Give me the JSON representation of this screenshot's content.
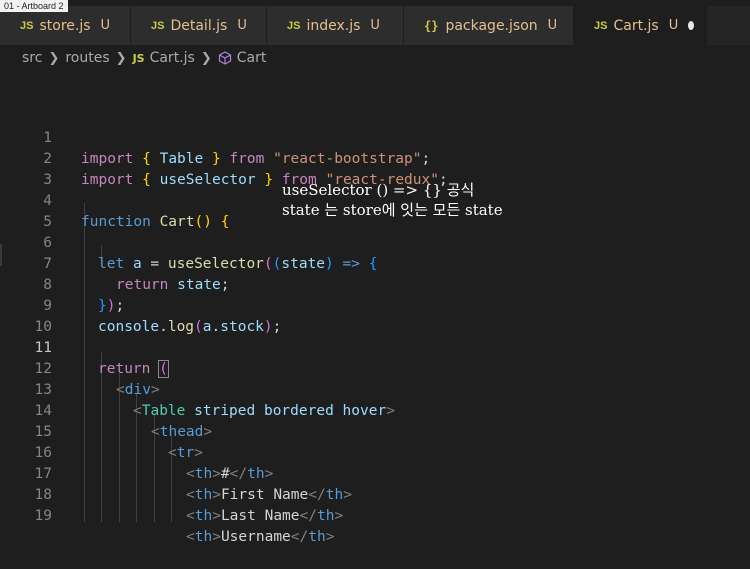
{
  "artboard": "01 - Artboard 2",
  "tabs": [
    {
      "badge": "JS",
      "name": "store.js",
      "status": "U",
      "active": false
    },
    {
      "badge": "JS",
      "name": "Detail.js",
      "status": "U",
      "active": false
    },
    {
      "badge": "JS",
      "name": "index.js",
      "status": "U",
      "active": false
    },
    {
      "badge": "{}",
      "name": "package.json",
      "status": "U",
      "active": false
    },
    {
      "badge": "JS",
      "name": "Cart.js",
      "status": "U",
      "active": true
    }
  ],
  "breadcrumb": {
    "items": [
      "src",
      "routes",
      "Cart.js",
      "Cart"
    ],
    "js_badge": "JS"
  },
  "line_numbers": [
    "1",
    "2",
    "3",
    "4",
    "5",
    "6",
    "7",
    "8",
    "9",
    "10",
    "11",
    "12",
    "13",
    "14",
    "15",
    "16",
    "17",
    "18",
    "19"
  ],
  "code": {
    "l1": [
      "import",
      " ",
      "{",
      " Table ",
      "}",
      " from ",
      "\"react-bootstrap\"",
      ";"
    ],
    "l2": [
      "import",
      " ",
      "{",
      " useSelector ",
      "}",
      " from ",
      "\"react-redux\"",
      ";"
    ],
    "l4": [
      "function",
      " ",
      "Cart",
      "()",
      " ",
      "{"
    ],
    "l6": [
      "let",
      " ",
      "a",
      " = ",
      "useSelector",
      "(",
      "(",
      "state",
      ")",
      " => ",
      "{"
    ],
    "l7": [
      "return",
      " ",
      "state",
      ";"
    ],
    "l8": [
      "}",
      ")",
      ";"
    ],
    "l9": [
      "console",
      ".",
      "log",
      "(",
      "a",
      ".",
      "stock",
      ")",
      ";"
    ],
    "l11": [
      "return",
      " ",
      "("
    ],
    "l12": [
      "<",
      "div",
      ">"
    ],
    "l13": [
      "<",
      "Table",
      " ",
      "striped",
      " ",
      "bordered",
      " ",
      "hover",
      ">"
    ],
    "l14": [
      "<",
      "thead",
      ">"
    ],
    "l15": [
      "<",
      "tr",
      ">"
    ],
    "l16": [
      "<",
      "th",
      ">",
      "#",
      "</",
      "th",
      ">"
    ],
    "l17": [
      "<",
      "th",
      ">",
      "First Name",
      "</",
      "th",
      ">"
    ],
    "l18": [
      "<",
      "th",
      ">",
      "Last Name",
      "</",
      "th",
      ">"
    ],
    "l19": [
      "<",
      "th",
      ">",
      "Username",
      "</",
      "th",
      ">"
    ]
  },
  "note": {
    "line1": "useSelector () => {}  공식",
    "line2": "state 는 store에 잇는 모든 state"
  }
}
